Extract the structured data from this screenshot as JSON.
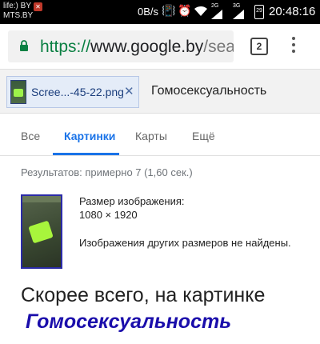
{
  "status_bar": {
    "carrier_line1": "life:) BY",
    "carrier_line2": "MTS.BY",
    "speed": "0B/s",
    "signal_2g": "2G",
    "signal_3g": "3G",
    "battery": "29",
    "time": "20:48:16"
  },
  "address_bar": {
    "url_scheme": "https://",
    "url_host": "www.google.by",
    "url_rest": "/searc",
    "tab_count": "2"
  },
  "search": {
    "image_chip_label": "Scree...-45-22.png",
    "query": "Гомосексуальность"
  },
  "tabs": [
    {
      "label": "Все",
      "active": false
    },
    {
      "label": "Картинки",
      "active": true
    },
    {
      "label": "Карты",
      "active": false
    },
    {
      "label": "Ещё",
      "active": false
    }
  ],
  "results_count": "Результатов: примерно 7 (1,60 сек.)",
  "image_info": {
    "size_label": "Размер изображения:",
    "size_value": "1080 × 1920",
    "other_sizes": "Изображения других размеров не найдены."
  },
  "best_guess": {
    "text": "Скорее всего, на картинке",
    "link": "Гомосексуальность"
  },
  "colors": {
    "accent": "#1a73e8",
    "link": "#1a0dab",
    "secure": "#0b8043"
  }
}
